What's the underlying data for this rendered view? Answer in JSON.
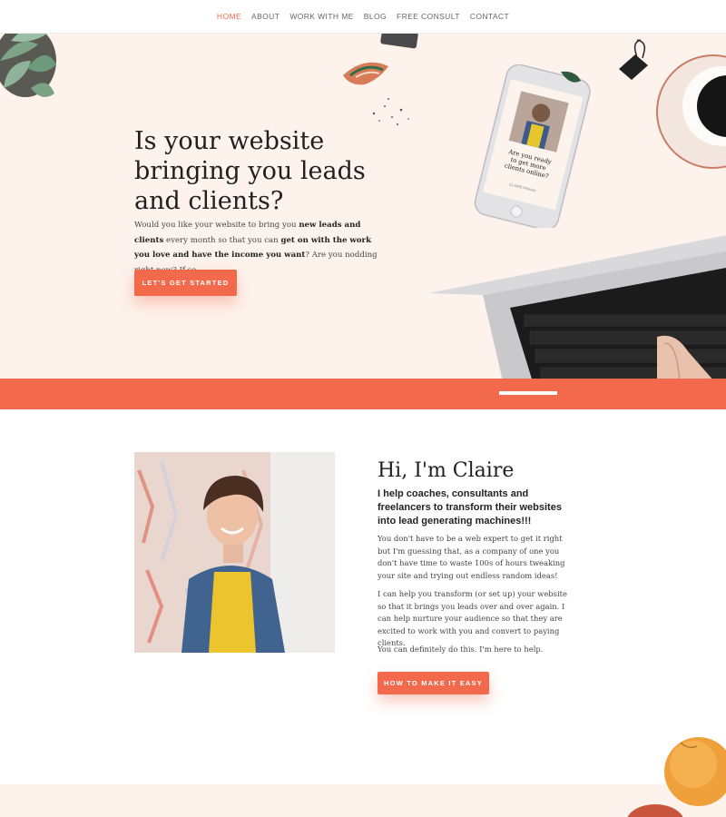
{
  "nav": {
    "items": [
      {
        "label": "HOME",
        "active": true
      },
      {
        "label": "ABOUT",
        "active": false
      },
      {
        "label": "WORK WITH ME",
        "active": false
      },
      {
        "label": "BLOG",
        "active": false
      },
      {
        "label": "FREE CONSULT",
        "active": false
      },
      {
        "label": "CONTACT",
        "active": false
      }
    ]
  },
  "hero": {
    "title": "Is your website bringing you leads and clients?",
    "text_parts": [
      {
        "t": "Would you like your website to bring you ",
        "b": false
      },
      {
        "t": "new leads and clients",
        "b": true
      },
      {
        "t": " every month so that you can ",
        "b": false
      },
      {
        "t": "get on with the work you love and have the income you want",
        "b": true
      },
      {
        "t": "? Are you nodding right now? If so...",
        "b": false
      }
    ],
    "cta_label": "LET'S GET STARTED",
    "phone_text": "Are you ready to get more clients online?",
    "phone_brand": "CLAIRE PRAMA"
  },
  "about": {
    "title": "Hi, I'm Claire",
    "subtitle": "I help coaches, consultants and freelancers to transform their websites into lead generating machines!!!",
    "p1": "You don't have to be a web expert to get it right but I'm guessing that, as a company of one you don't have time to waste 100s of hours tweaking your site and trying out endless random ideas!",
    "p2": "I can help you transform (or set up) your website so that it brings you leads over and over again. I can help nurture your audience so that they are excited to work with you and convert to paying clients.",
    "p3": "You can definitely do this. I'm here to help.",
    "cta_label": "HOW TO MAKE IT EASY"
  },
  "colors": {
    "accent": "#f26a4b",
    "hero_bg": "#fdf2ec",
    "heading": "#1f1f1f"
  },
  "icons": [
    "plant-decoration",
    "paperclip-icon",
    "coffee-cup",
    "pencil-shavings",
    "smartphone",
    "laptop",
    "peach-fruit"
  ]
}
